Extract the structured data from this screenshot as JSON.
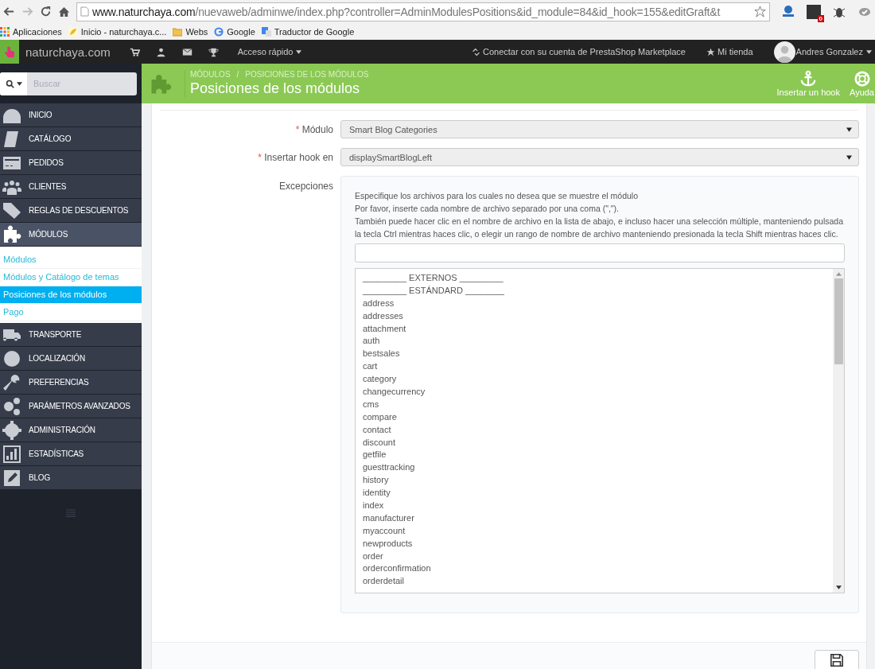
{
  "browser": {
    "url_host": "www.naturchaya.com",
    "url_path": "/nuevaweb/adminwe/index.php?controller=AdminModulesPositions&id_module=84&id_hook=155&editGraft&t",
    "extension_badge": "0",
    "bookmarks": [
      "Aplicaciones",
      "Inicio - naturchaya.c...",
      "Webs",
      "Google",
      "Traductor de Google"
    ]
  },
  "topbar": {
    "shop": "naturchaya.com",
    "quick_access": "Acceso rápido",
    "marketplace": "Conectar con su cuenta de PrestaShop Marketplace",
    "my_shop": "Mi tienda",
    "user": "Andres Gonzalez"
  },
  "sidebar": {
    "search_placeholder": "Buscar",
    "items": [
      {
        "label": "INICIO",
        "selected": false
      },
      {
        "label": "CATÁLOGO",
        "selected": false
      },
      {
        "label": "PEDIDOS",
        "selected": false
      },
      {
        "label": "CLIENTES",
        "selected": false
      },
      {
        "label": "REGLAS DE DESCUENTOS",
        "selected": false
      },
      {
        "label": "MÓDULOS",
        "selected": true,
        "children": [
          {
            "label": "Módulos",
            "selected": false
          },
          {
            "label": "Módulos y Catálogo de temas",
            "selected": false
          },
          {
            "label": "Posiciones de los módulos",
            "selected": true
          },
          {
            "label": "Pago",
            "selected": false
          }
        ]
      },
      {
        "label": "TRANSPORTE",
        "selected": false
      },
      {
        "label": "LOCALIZACIÓN",
        "selected": false
      },
      {
        "label": "PREFERENCIAS",
        "selected": false
      },
      {
        "label": "PARÁMETROS AVANZADOS",
        "selected": false
      },
      {
        "label": "ADMINISTRACIÓN",
        "selected": false
      },
      {
        "label": "ESTADÍSTICAS",
        "selected": false
      },
      {
        "label": "BLOG",
        "selected": false
      }
    ]
  },
  "header": {
    "breadcrumb": [
      "MÓDULOS",
      "POSICIONES DE LOS MÓDULOS"
    ],
    "breadcrumb_separator": "/",
    "title": "Posiciones de los módulos",
    "actions": [
      "Insertar un hook",
      "Ayuda"
    ]
  },
  "form": {
    "fields": [
      {
        "label": "Módulo",
        "required_mark": "*",
        "value": "Smart Blog Categories"
      },
      {
        "label": "Insertar hook en",
        "required_mark": "*",
        "value": "displaySmartBlogLeft"
      }
    ],
    "exceptions": {
      "label": "Excepciones",
      "help": [
        "Especifique los archivos para los cuales no desea que se muestre el módulo",
        "Por favor, inserte cada nombre de archivo separado por una coma (\",\").",
        "También puede hacer clic en el nombre de archivo en la lista de abajo, e incluso hacer una selección múltiple, manteniendo pulsada la tecla Ctrl mientras haces clic, o elegir un rango de nombre de archivo manteniendo presionada la tecla Shift mientras haces clic."
      ],
      "options": [
        {
          "label": "_________ EXTERNOS _________",
          "selected": false
        },
        {
          "label": "_________ ESTÁNDARD ________",
          "selected": false
        },
        {
          "label": "address",
          "selected": false
        },
        {
          "label": "addresses",
          "selected": false
        },
        {
          "label": "attachment",
          "selected": false
        },
        {
          "label": "auth",
          "selected": false
        },
        {
          "label": "bestsales",
          "selected": false
        },
        {
          "label": "cart",
          "selected": false
        },
        {
          "label": "category",
          "selected": false
        },
        {
          "label": "changecurrency",
          "selected": false
        },
        {
          "label": "cms",
          "selected": false
        },
        {
          "label": "compare",
          "selected": false
        },
        {
          "label": "contact",
          "selected": false
        },
        {
          "label": "discount",
          "selected": false
        },
        {
          "label": "getfile",
          "selected": false
        },
        {
          "label": "guesttracking",
          "selected": false
        },
        {
          "label": "history",
          "selected": false
        },
        {
          "label": "identity",
          "selected": false
        },
        {
          "label": "index",
          "selected": false
        },
        {
          "label": "manufacturer",
          "selected": false
        },
        {
          "label": "myaccount",
          "selected": false
        },
        {
          "label": "newproducts",
          "selected": false
        },
        {
          "label": "order",
          "selected": false
        },
        {
          "label": "orderconfirmation",
          "selected": false
        },
        {
          "label": "orderdetail",
          "selected": false
        }
      ]
    }
  }
}
